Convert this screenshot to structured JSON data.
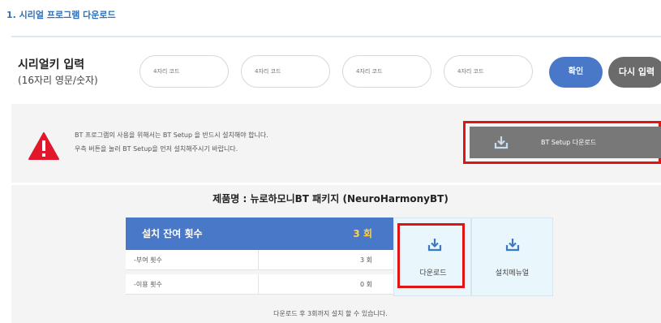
{
  "section": {
    "title": "1. 시리얼 프로그램 다운로드"
  },
  "serial": {
    "label": "시리얼키 입력",
    "sublabel": "(16자리 영문/숫자)",
    "inputs": [
      {
        "value": "",
        "placeholder": "4자리 코드"
      },
      {
        "value": "",
        "placeholder": "4자리 코드"
      },
      {
        "value": "",
        "placeholder": "4자리 코드"
      },
      {
        "value": "",
        "placeholder": "4자리 코드"
      }
    ],
    "confirm_label": "확인",
    "reenter_label": "다시 입력"
  },
  "notice": {
    "icon": "warning-icon",
    "line1": "BT 프로그램의 사용을 위해서는 BT Setup 을 반드시 설치해야 합니다.",
    "line2": "우측 버튼을 눌러 BT Setup을 먼저 설치해주시기 바랍니다.",
    "bt_setup_label": "BT Setup 다운로드"
  },
  "product": {
    "name": "제품명 : 뉴로하모니BT 패키지 (NeuroHarmonyBT)",
    "install_remaining_label": "설치 잔여 횟수",
    "install_remaining_value": "3 회",
    "rows": [
      {
        "label": "-부여 횟수",
        "value": "3 회"
      },
      {
        "label": "-이용 횟수",
        "value": "0 회"
      }
    ],
    "download_label": "다운로드",
    "manual_label": "설치메뉴얼",
    "footnote": "다운로드 후 3회까지 설치 할 수 있습니다."
  },
  "colors": {
    "accent": "#4a78c8",
    "highlight": "#e01414",
    "panel": "#f4f4f4",
    "tile": "#e9f6fb"
  }
}
